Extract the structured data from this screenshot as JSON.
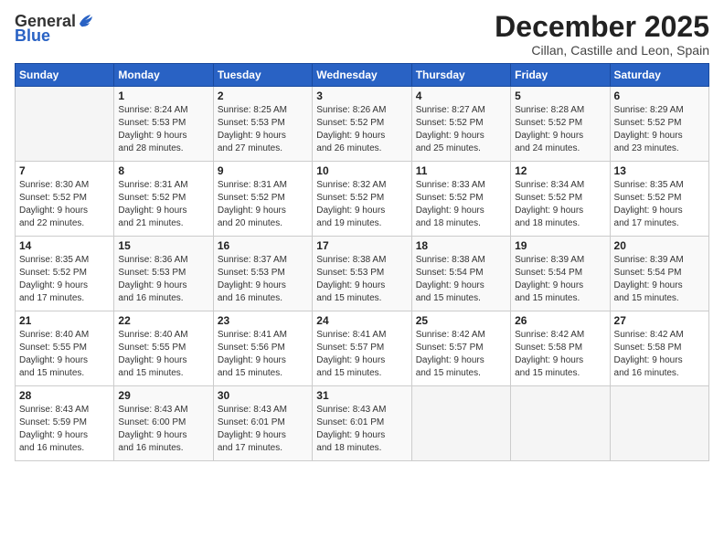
{
  "header": {
    "logo_general": "General",
    "logo_blue": "Blue",
    "title": "December 2025",
    "subtitle": "Cillan, Castille and Leon, Spain"
  },
  "calendar": {
    "days_of_week": [
      "Sunday",
      "Monday",
      "Tuesday",
      "Wednesday",
      "Thursday",
      "Friday",
      "Saturday"
    ],
    "weeks": [
      [
        {
          "day": "",
          "info": ""
        },
        {
          "day": "1",
          "info": "Sunrise: 8:24 AM\nSunset: 5:53 PM\nDaylight: 9 hours\nand 28 minutes."
        },
        {
          "day": "2",
          "info": "Sunrise: 8:25 AM\nSunset: 5:53 PM\nDaylight: 9 hours\nand 27 minutes."
        },
        {
          "day": "3",
          "info": "Sunrise: 8:26 AM\nSunset: 5:52 PM\nDaylight: 9 hours\nand 26 minutes."
        },
        {
          "day": "4",
          "info": "Sunrise: 8:27 AM\nSunset: 5:52 PM\nDaylight: 9 hours\nand 25 minutes."
        },
        {
          "day": "5",
          "info": "Sunrise: 8:28 AM\nSunset: 5:52 PM\nDaylight: 9 hours\nand 24 minutes."
        },
        {
          "day": "6",
          "info": "Sunrise: 8:29 AM\nSunset: 5:52 PM\nDaylight: 9 hours\nand 23 minutes."
        }
      ],
      [
        {
          "day": "7",
          "info": "Sunrise: 8:30 AM\nSunset: 5:52 PM\nDaylight: 9 hours\nand 22 minutes."
        },
        {
          "day": "8",
          "info": "Sunrise: 8:31 AM\nSunset: 5:52 PM\nDaylight: 9 hours\nand 21 minutes."
        },
        {
          "day": "9",
          "info": "Sunrise: 8:31 AM\nSunset: 5:52 PM\nDaylight: 9 hours\nand 20 minutes."
        },
        {
          "day": "10",
          "info": "Sunrise: 8:32 AM\nSunset: 5:52 PM\nDaylight: 9 hours\nand 19 minutes."
        },
        {
          "day": "11",
          "info": "Sunrise: 8:33 AM\nSunset: 5:52 PM\nDaylight: 9 hours\nand 18 minutes."
        },
        {
          "day": "12",
          "info": "Sunrise: 8:34 AM\nSunset: 5:52 PM\nDaylight: 9 hours\nand 18 minutes."
        },
        {
          "day": "13",
          "info": "Sunrise: 8:35 AM\nSunset: 5:52 PM\nDaylight: 9 hours\nand 17 minutes."
        }
      ],
      [
        {
          "day": "14",
          "info": "Sunrise: 8:35 AM\nSunset: 5:52 PM\nDaylight: 9 hours\nand 17 minutes."
        },
        {
          "day": "15",
          "info": "Sunrise: 8:36 AM\nSunset: 5:53 PM\nDaylight: 9 hours\nand 16 minutes."
        },
        {
          "day": "16",
          "info": "Sunrise: 8:37 AM\nSunset: 5:53 PM\nDaylight: 9 hours\nand 16 minutes."
        },
        {
          "day": "17",
          "info": "Sunrise: 8:38 AM\nSunset: 5:53 PM\nDaylight: 9 hours\nand 15 minutes."
        },
        {
          "day": "18",
          "info": "Sunrise: 8:38 AM\nSunset: 5:54 PM\nDaylight: 9 hours\nand 15 minutes."
        },
        {
          "day": "19",
          "info": "Sunrise: 8:39 AM\nSunset: 5:54 PM\nDaylight: 9 hours\nand 15 minutes."
        },
        {
          "day": "20",
          "info": "Sunrise: 8:39 AM\nSunset: 5:54 PM\nDaylight: 9 hours\nand 15 minutes."
        }
      ],
      [
        {
          "day": "21",
          "info": "Sunrise: 8:40 AM\nSunset: 5:55 PM\nDaylight: 9 hours\nand 15 minutes."
        },
        {
          "day": "22",
          "info": "Sunrise: 8:40 AM\nSunset: 5:55 PM\nDaylight: 9 hours\nand 15 minutes."
        },
        {
          "day": "23",
          "info": "Sunrise: 8:41 AM\nSunset: 5:56 PM\nDaylight: 9 hours\nand 15 minutes."
        },
        {
          "day": "24",
          "info": "Sunrise: 8:41 AM\nSunset: 5:57 PM\nDaylight: 9 hours\nand 15 minutes."
        },
        {
          "day": "25",
          "info": "Sunrise: 8:42 AM\nSunset: 5:57 PM\nDaylight: 9 hours\nand 15 minutes."
        },
        {
          "day": "26",
          "info": "Sunrise: 8:42 AM\nSunset: 5:58 PM\nDaylight: 9 hours\nand 15 minutes."
        },
        {
          "day": "27",
          "info": "Sunrise: 8:42 AM\nSunset: 5:58 PM\nDaylight: 9 hours\nand 16 minutes."
        }
      ],
      [
        {
          "day": "28",
          "info": "Sunrise: 8:43 AM\nSunset: 5:59 PM\nDaylight: 9 hours\nand 16 minutes."
        },
        {
          "day": "29",
          "info": "Sunrise: 8:43 AM\nSunset: 6:00 PM\nDaylight: 9 hours\nand 16 minutes."
        },
        {
          "day": "30",
          "info": "Sunrise: 8:43 AM\nSunset: 6:01 PM\nDaylight: 9 hours\nand 17 minutes."
        },
        {
          "day": "31",
          "info": "Sunrise: 8:43 AM\nSunset: 6:01 PM\nDaylight: 9 hours\nand 18 minutes."
        },
        {
          "day": "",
          "info": ""
        },
        {
          "day": "",
          "info": ""
        },
        {
          "day": "",
          "info": ""
        }
      ]
    ]
  }
}
